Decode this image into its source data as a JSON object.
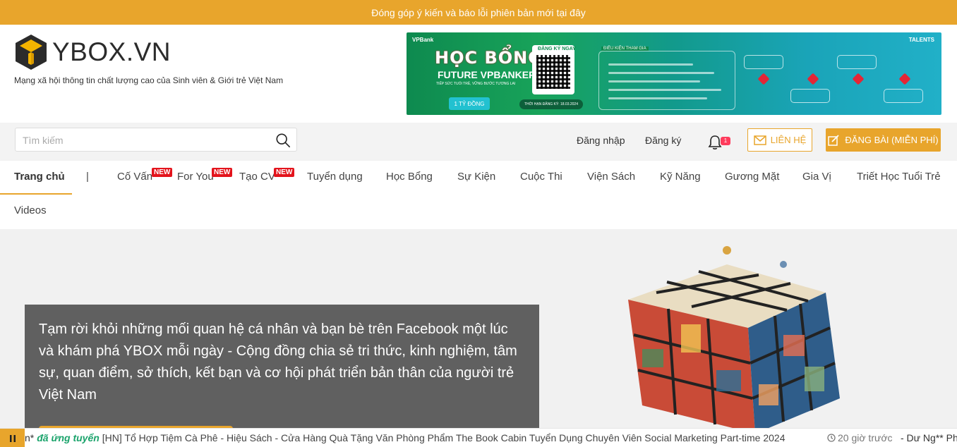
{
  "topbar": {
    "text": "Đóng góp ý kiến và báo lỗi phiên bản mới",
    "link": "tại đây"
  },
  "header": {
    "logo_text": "YBOX.VN",
    "tagline": "Mạng xã hội thông tin chất lượng cao của Sinh viên & Giới trẻ Việt Nam",
    "banner": {
      "brand": "VPBank",
      "title": "HỌC BỔNG",
      "subtitle": "FUTURE VPBANKER",
      "small": "TIẾP SỨC TUỔI TRẺ, VỮNG BƯỚC TƯƠNG LAI",
      "prize": "1 TỶ ĐỒNG",
      "register": "ĐĂNG KÝ NGAY",
      "deadline": "THỜI HẠN ĐĂNG KÝ: 18.03.2024",
      "conditions": "ĐIỀU KIỆN THAM GIA",
      "talents": "TALENTS"
    }
  },
  "toolbar": {
    "search_placeholder": "Tìm kiếm",
    "login": "Đăng nhập",
    "register": "Đăng ký",
    "notification_count": "1",
    "contact": "LIÊN HỆ",
    "post": "ĐĂNG BÀI (MIỄN PHÍ)"
  },
  "nav": {
    "items": [
      {
        "label": "Trang chủ"
      },
      {
        "label": "|"
      },
      {
        "label": "Cố Vấn",
        "badge": "NEW"
      },
      {
        "label": "For You",
        "badge": "NEW"
      },
      {
        "label": "Tạo CV",
        "badge": "NEW"
      },
      {
        "label": "Tuyển dụng"
      },
      {
        "label": "Học Bổng"
      },
      {
        "label": "Sự Kiện"
      },
      {
        "label": "Cuộc Thi"
      },
      {
        "label": "Viện Sách"
      },
      {
        "label": "Kỹ Năng"
      },
      {
        "label": "Gương Mặt"
      },
      {
        "label": "Gia Vị"
      },
      {
        "label": "Triết Học Tuổi Trẻ"
      },
      {
        "label": "Videos"
      }
    ]
  },
  "hero": {
    "text": "Tạm rời khỏi những mối quan hệ cá nhân và bạn bè trên Facebook một lúc và khám phá YBOX mỗi ngày - Cộng đồng chia sẻ tri thức, kinh nghiệm, tâm sự, quan điểm, sở thích, kết bạn và cơ hội phát triển bản thân của người trẻ Việt Nam"
  },
  "ticker": {
    "user": "n*",
    "action": "đã ứng tuyển",
    "title": "[HN] Tổ Hợp Tiệm Cà Phê - Hiệu Sách - Cửa Hàng Quà Tặng Văn Phòng Phẩm The Book Cabin Tuyển Dụng Chuyên Viên Social Marketing Part-time 2024",
    "time": "20 giờ trước",
    "next_user": "- Dư Ng** Ph**"
  },
  "colors": {
    "accent": "#e8a52c",
    "new_badge": "#e3141c",
    "action": "#1aa36b"
  }
}
